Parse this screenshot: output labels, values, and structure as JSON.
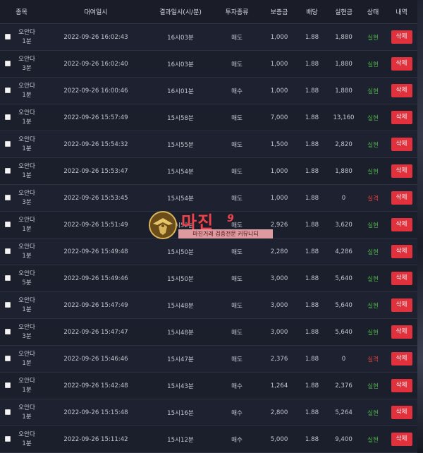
{
  "headers": {
    "game": "종목",
    "bet_time": "대여일시",
    "result_time": "결과일시(시/분)",
    "type": "투자종류",
    "stake": "보증금",
    "odds": "배당",
    "payout": "실현금",
    "status": "상태",
    "action": "내역"
  },
  "rows": [
    {
      "game_a": "오안다",
      "game_b": "1분",
      "bet_time": "2022-09-26 16:02:43",
      "result_time": "16시03분",
      "type": "매도",
      "stake": "1,000",
      "odds": "1.88",
      "payout": "1,880",
      "status": "실현",
      "delete": "삭제"
    },
    {
      "game_a": "오안다",
      "game_b": "3분",
      "bet_time": "2022-09-26 16:02:40",
      "result_time": "16시03분",
      "type": "매도",
      "stake": "1,000",
      "odds": "1.88",
      "payout": "1,880",
      "status": "실현",
      "delete": "삭제"
    },
    {
      "game_a": "오안다",
      "game_b": "1분",
      "bet_time": "2022-09-26 16:00:46",
      "result_time": "16시01분",
      "type": "매수",
      "stake": "1,000",
      "odds": "1.88",
      "payout": "1,880",
      "status": "실현",
      "delete": "삭제"
    },
    {
      "game_a": "오안다",
      "game_b": "1분",
      "bet_time": "2022-09-26 15:57:49",
      "result_time": "15시58분",
      "type": "매도",
      "stake": "7,000",
      "odds": "1.88",
      "payout": "13,160",
      "status": "실현",
      "delete": "삭제"
    },
    {
      "game_a": "오안다",
      "game_b": "1분",
      "bet_time": "2022-09-26 15:54:32",
      "result_time": "15시55분",
      "type": "매도",
      "stake": "1,500",
      "odds": "1.88",
      "payout": "2,820",
      "status": "실현",
      "delete": "삭제"
    },
    {
      "game_a": "오안다",
      "game_b": "1분",
      "bet_time": "2022-09-26 15:53:47",
      "result_time": "15시54분",
      "type": "매도",
      "stake": "1,000",
      "odds": "1.88",
      "payout": "1,880",
      "status": "실현",
      "delete": "삭제"
    },
    {
      "game_a": "오안다",
      "game_b": "3분",
      "bet_time": "2022-09-26 15:53:45",
      "result_time": "15시54분",
      "type": "매도",
      "stake": "1,000",
      "odds": "1.88",
      "payout": "0",
      "status": "실격",
      "delete": "삭제"
    },
    {
      "game_a": "오안다",
      "game_b": "1분",
      "bet_time": "2022-09-26 15:51:49",
      "result_time": "15시52분",
      "type": "매도",
      "stake": "2,926",
      "odds": "1.88",
      "payout": "3,620",
      "status": "실현",
      "delete": "삭제"
    },
    {
      "game_a": "오안다",
      "game_b": "1분",
      "bet_time": "2022-09-26 15:49:48",
      "result_time": "15시50분",
      "type": "매도",
      "stake": "2,280",
      "odds": "1.88",
      "payout": "4,286",
      "status": "실현",
      "delete": "삭제"
    },
    {
      "game_a": "오안다",
      "game_b": "5분",
      "bet_time": "2022-09-26 15:49:46",
      "result_time": "15시50분",
      "type": "매도",
      "stake": "3,000",
      "odds": "1.88",
      "payout": "5,640",
      "status": "실현",
      "delete": "삭제"
    },
    {
      "game_a": "오안다",
      "game_b": "1분",
      "bet_time": "2022-09-26 15:47:49",
      "result_time": "15시48분",
      "type": "매도",
      "stake": "3,000",
      "odds": "1.88",
      "payout": "5,640",
      "status": "실현",
      "delete": "삭제"
    },
    {
      "game_a": "오안다",
      "game_b": "3분",
      "bet_time": "2022-09-26 15:47:47",
      "result_time": "15시48분",
      "type": "매도",
      "stake": "3,000",
      "odds": "1.88",
      "payout": "5,640",
      "status": "실현",
      "delete": "삭제"
    },
    {
      "game_a": "오안다",
      "game_b": "1분",
      "bet_time": "2022-09-26 15:46:46",
      "result_time": "15시47분",
      "type": "매도",
      "stake": "2,376",
      "odds": "1.88",
      "payout": "0",
      "status": "실격",
      "delete": "삭제"
    },
    {
      "game_a": "오안다",
      "game_b": "1분",
      "bet_time": "2022-09-26 15:42:48",
      "result_time": "15시43분",
      "type": "매수",
      "stake": "1,264",
      "odds": "1.88",
      "payout": "2,376",
      "status": "실현",
      "delete": "삭제"
    },
    {
      "game_a": "오안다",
      "game_b": "1분",
      "bet_time": "2022-09-26 15:15:48",
      "result_time": "15시16분",
      "type": "매수",
      "stake": "2,800",
      "odds": "1.88",
      "payout": "5,264",
      "status": "실현",
      "delete": "삭제"
    },
    {
      "game_a": "오안다",
      "game_b": "1분",
      "bet_time": "2022-09-26 15:11:42",
      "result_time": "15시12분",
      "type": "매수",
      "stake": "5,000",
      "odds": "1.88",
      "payout": "9,400",
      "status": "실현",
      "delete": "삭제"
    }
  ],
  "watermark": {
    "title": "마진",
    "badge": "9",
    "subtitle": "마진거래 검증전문 커뮤니티"
  },
  "colors": {
    "background": "#1c1f2b",
    "win": "#4fb348",
    "lose": "#e23b3b",
    "delete_button": "#e0313d"
  }
}
